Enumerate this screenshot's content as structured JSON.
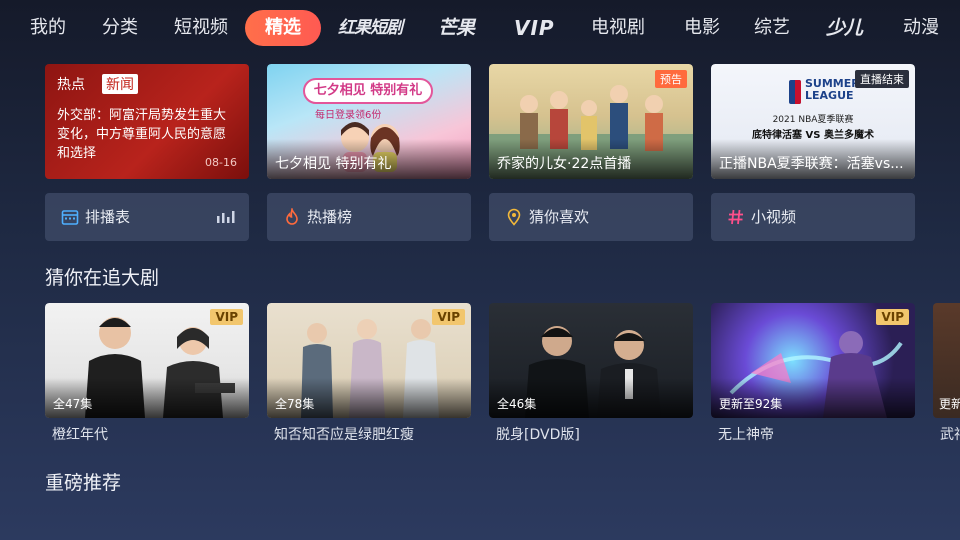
{
  "nav": {
    "items": [
      "我的",
      "分类",
      "短视频",
      "精选",
      "红果短剧",
      "芒果",
      "VIP",
      "电视剧",
      "电影",
      "综艺",
      "少儿",
      "动漫"
    ]
  },
  "news": {
    "tag_hot": "热点",
    "tag_news": "新闻",
    "text": "外交部：阿富汗局势发生重大变化，中方尊重阿人民的意愿和选择",
    "date": "08-16"
  },
  "banners": [
    {
      "caption": "七夕相见 特别有礼",
      "poster_text": "七夕相见 特别有礼",
      "poster_sub": "每日登录领6份",
      "badge": ""
    },
    {
      "caption": "乔家的儿女·22点首播",
      "badge": "预告"
    },
    {
      "caption": "正播NBA夏季联赛：活塞vs...",
      "badge": "直播结束",
      "poster_top": "SUMMER LEAGUE",
      "poster_sub": "2021 NBA夏季联赛",
      "poster_vs": "底特律活塞 VS 奥兰多魔术"
    }
  ],
  "quick": [
    {
      "label": "排播表",
      "icon": "calendar-icon"
    },
    {
      "label": "热播榜",
      "icon": "flame-icon"
    },
    {
      "label": "猜你喜欢",
      "icon": "location-pin-icon"
    },
    {
      "label": "小视频",
      "icon": "hashtag-icon"
    }
  ],
  "section1": {
    "title": "猜你在追大剧"
  },
  "dramas": [
    {
      "title": "橙红年代",
      "episodes": "全47集",
      "badge": "VIP"
    },
    {
      "title": "知否知否应是绿肥红瘦",
      "episodes": "全78集",
      "badge": "VIP"
    },
    {
      "title": "脱身[DVD版]",
      "episodes": "全46集",
      "badge": ""
    },
    {
      "title": "无上神帝",
      "episodes": "更新至92集",
      "badge": "VIP"
    },
    {
      "title": "武神",
      "episodes": "更新",
      "badge": ""
    }
  ],
  "section2": {
    "title": "重磅推荐"
  },
  "colors": {
    "accent": "#ff6045",
    "vip_gold": "#f2c66d",
    "bg_top": "#151a2a",
    "bg_bottom": "#2c3a5f"
  }
}
